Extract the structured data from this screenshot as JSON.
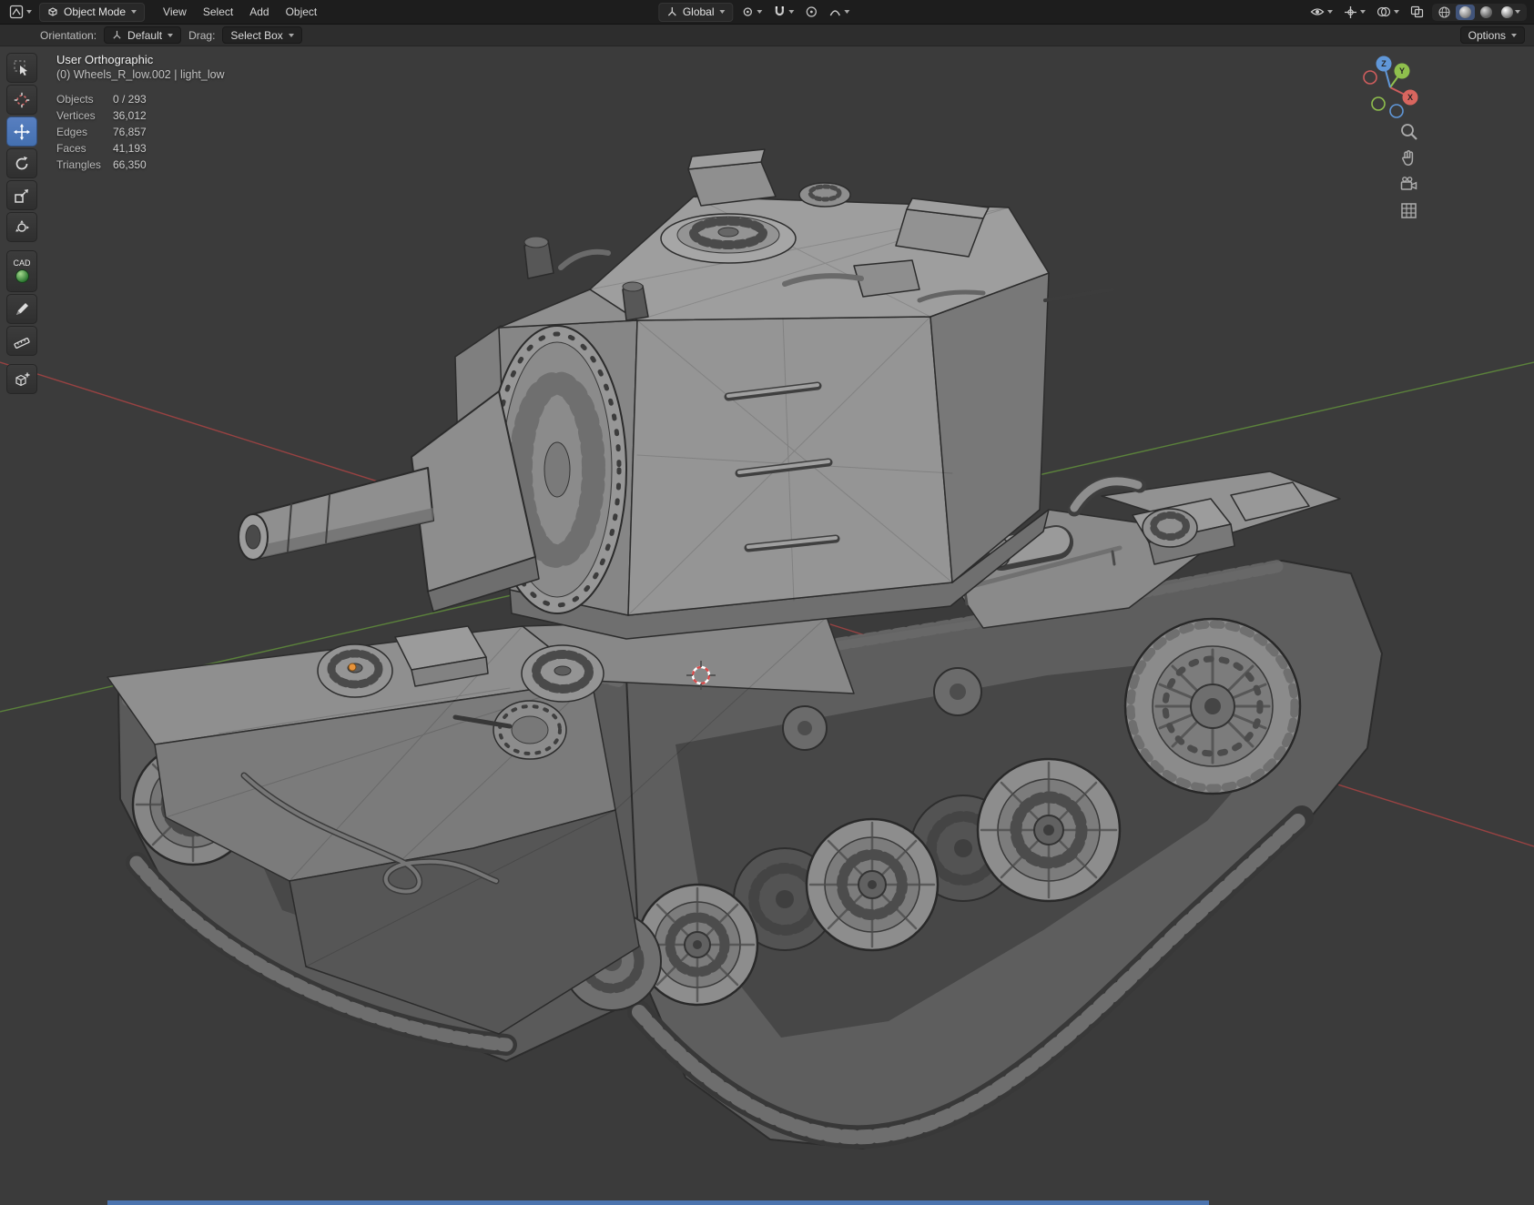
{
  "header": {
    "mode_label": "Object Mode",
    "menus": [
      "View",
      "Select",
      "Add",
      "Object"
    ],
    "orientation_value": "Global",
    "options_label": "Options"
  },
  "tool_settings": {
    "orientation_label": "Orientation:",
    "orientation_value": "Default",
    "drag_label": "Drag:",
    "drag_value": "Select Box"
  },
  "toolbar": {
    "cad_label": "CAD"
  },
  "overlay": {
    "view_label": "User Orthographic",
    "active_object": "(0) Wheels_R_low.002 | light_low",
    "stats": [
      {
        "label": "Objects",
        "value": "0 / 293"
      },
      {
        "label": "Vertices",
        "value": "36,012"
      },
      {
        "label": "Edges",
        "value": "76,857"
      },
      {
        "label": "Faces",
        "value": "41,193"
      },
      {
        "label": "Triangles",
        "value": "66,350"
      }
    ]
  },
  "gizmo": {
    "x_label": "X",
    "y_label": "Y",
    "z_label": "Z"
  },
  "colors": {
    "accent": "#4772b3",
    "axis_x": "#9e4343",
    "axis_y": "#5f8a3c",
    "axis_z": "#3b83bd",
    "viewport_bg": "#3b3b3b"
  }
}
